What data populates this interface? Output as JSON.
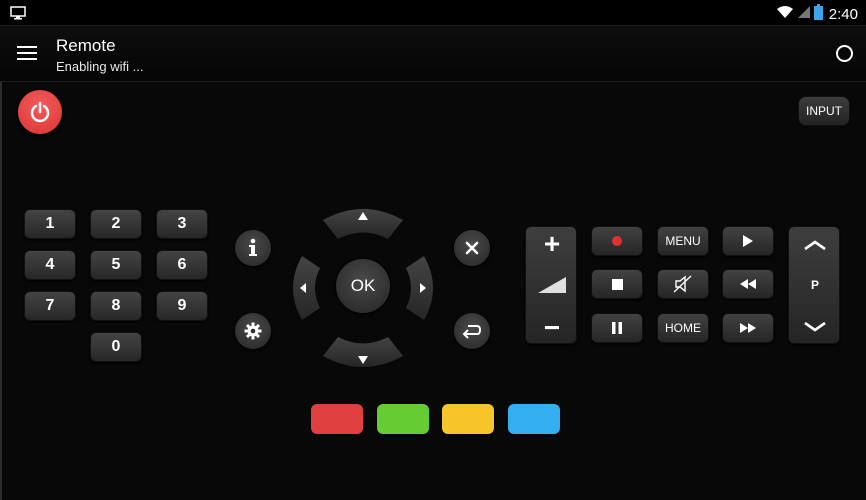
{
  "status_bar": {
    "time": "2:40"
  },
  "app_bar": {
    "title": "Remote",
    "subtitle": "Enabling wifi ..."
  },
  "top_controls": {
    "input_label": "INPUT"
  },
  "numpad": {
    "keys": [
      "1",
      "2",
      "3",
      "4",
      "5",
      "6",
      "7",
      "8",
      "9",
      "0"
    ]
  },
  "dpad": {
    "ok_label": "OK"
  },
  "volume": {
    "plus": "+",
    "minus": "−"
  },
  "media": {
    "menu_label": "MENU",
    "home_label": "HOME"
  },
  "channel": {
    "label": "P"
  },
  "colors": {
    "red": "#e0403f",
    "green": "#66cc33",
    "yellow": "#f5c52a",
    "blue": "#33aef0",
    "power": "#dd3535"
  }
}
